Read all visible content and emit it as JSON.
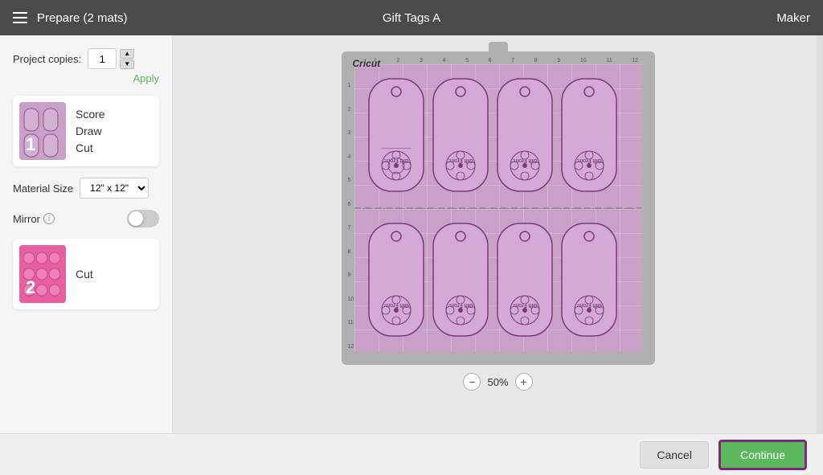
{
  "header": {
    "menu_label": "menu",
    "title": "Prepare (2 mats)",
    "center_title": "Gift Tags A",
    "machine": "Maker"
  },
  "left_panel": {
    "copies_label": "Project copies:",
    "copies_value": "1",
    "apply_label": "Apply",
    "mat1": {
      "number": "1",
      "operations": "Score\nDraw\nCut"
    },
    "material_size_label": "Material Size",
    "material_size_value": "12\" x 12\"",
    "mirror_label": "Mirror",
    "mat2": {
      "number": "2",
      "operations": "Cut"
    }
  },
  "canvas": {
    "zoom_label": "50%",
    "zoom_minus": "−",
    "zoom_plus": "+"
  },
  "footer": {
    "cancel_label": "Cancel",
    "continue_label": "Continue"
  },
  "cricut_logo": "Cricut"
}
